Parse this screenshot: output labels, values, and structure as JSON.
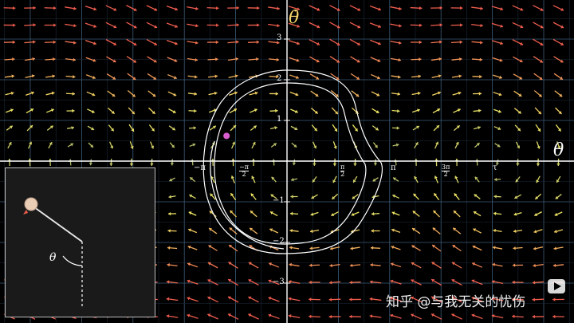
{
  "axes": {
    "x_label": "θ",
    "y_label": "θ̇",
    "y_ticks": [
      {
        "value": 3,
        "label": "3"
      },
      {
        "value": 2,
        "label": "2"
      },
      {
        "value": 1,
        "label": "1"
      },
      {
        "value": -1,
        "label": "−1"
      },
      {
        "value": -2,
        "label": "−2"
      },
      {
        "value": -3,
        "label": "−3"
      }
    ],
    "x_tick_labels": {
      "neg_pi": "−π",
      "neg_pi_half_num": "−π",
      "neg_pi_half_den": "2",
      "pi_half_num": "π",
      "pi_half_den": "2",
      "pi": "π",
      "three_pi_half_num": "3π",
      "three_pi_half_den": "2",
      "two_pi": "τ"
    }
  },
  "trajectory_point": {
    "theta": -1.85,
    "theta_dot": 0.62,
    "color": "#d85ed0"
  },
  "colors": {
    "grid_minor": "#1c2a3a",
    "grid_major": "#3c5d78",
    "axis": "#ffffff",
    "field_low": "#9aa86a",
    "field_mid": "#f2e866",
    "field_high": "#ef5d4e",
    "trajectory": "#ffffff",
    "pendulum_bob": "#e9cdb5",
    "inset_background": "#1a1a1a"
  },
  "inset": {
    "angle_label": "θ"
  },
  "watermark": {
    "text": "知乎 @与我无关的忧伤"
  },
  "icons": {
    "play": "play-icon"
  }
}
